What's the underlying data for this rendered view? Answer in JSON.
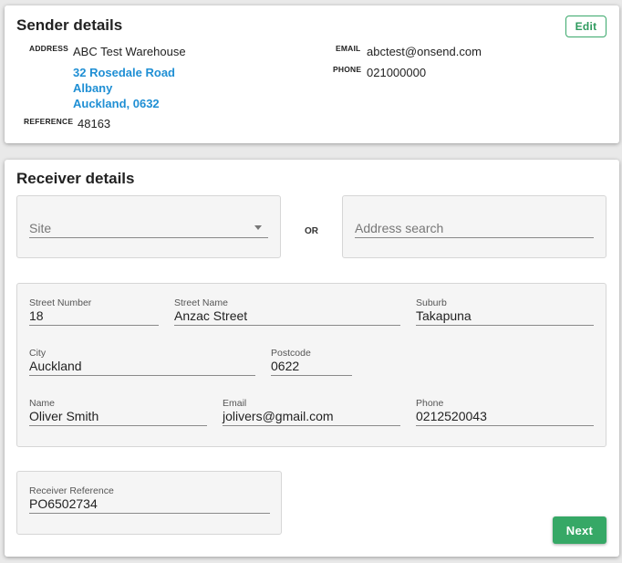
{
  "sender": {
    "title": "Sender details",
    "edit_label": "Edit",
    "address_label": "ADDRESS",
    "address_name": "ABC Test Warehouse",
    "address_lines": [
      "32 Rosedale Road",
      "Albany",
      "Auckland, 0632"
    ],
    "reference_label": "REFERENCE",
    "reference_value": "48163",
    "email_label": "EMAIL",
    "email_value": "abctest@onsend.com",
    "phone_label": "PHONE",
    "phone_value": "021000000"
  },
  "receiver": {
    "title": "Receiver details",
    "site_placeholder": "Site",
    "or_label": "OR",
    "address_search_placeholder": "Address search",
    "fields": {
      "street_number": {
        "label": "Street Number",
        "value": "18"
      },
      "street_name": {
        "label": "Street Name",
        "value": "Anzac Street"
      },
      "suburb": {
        "label": "Suburb",
        "value": "Takapuna"
      },
      "city": {
        "label": "City",
        "value": "Auckland"
      },
      "postcode": {
        "label": "Postcode",
        "value": "0622"
      },
      "name": {
        "label": "Name",
        "value": "Oliver Smith"
      },
      "email": {
        "label": "Email",
        "value": "jolivers@gmail.com"
      },
      "phone": {
        "label": "Phone",
        "value": "0212520043"
      },
      "reference": {
        "label": "Receiver Reference",
        "value": "PO6502734"
      }
    },
    "next_label": "Next"
  },
  "colors": {
    "accent_green": "#36a866",
    "link_blue": "#1f8fd4",
    "panel_bg": "#f5f5f5"
  }
}
